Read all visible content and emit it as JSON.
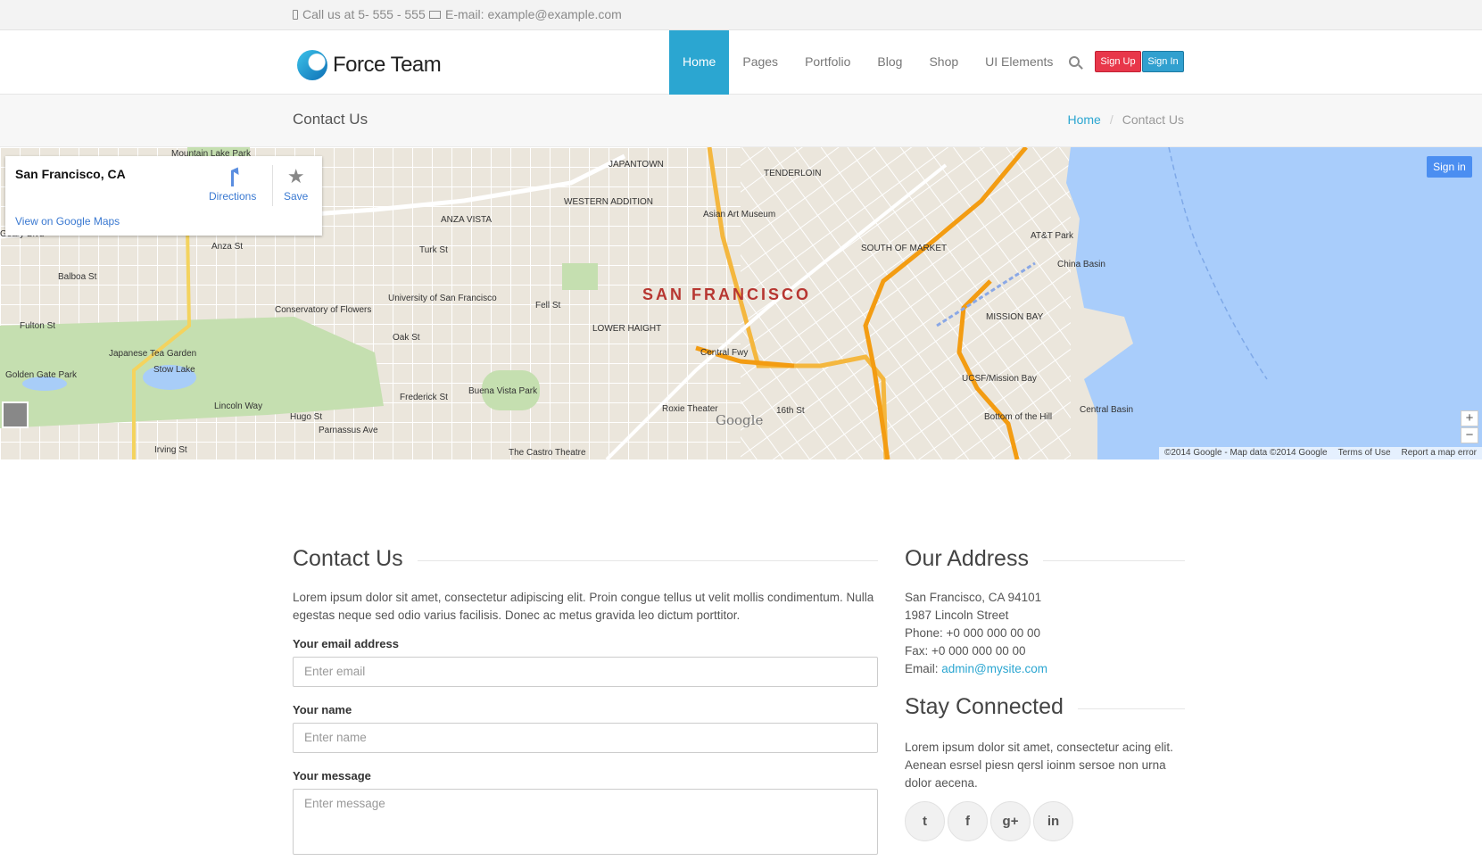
{
  "topbar": {
    "phone": "Call us at 5- 555 - 555",
    "email": "E-mail: example@example.com"
  },
  "header": {
    "logo_text": "Force Team",
    "nav": [
      "Home",
      "Pages",
      "Portfolio",
      "Blog",
      "Shop",
      "UI Elements"
    ],
    "active_nav": "Home",
    "sign_up": "Sign Up",
    "sign_in": "Sign In",
    "colors": {
      "accent": "#2ba6d1",
      "signup": "#e8374a"
    }
  },
  "page_header": {
    "title": "Contact Us",
    "breadcrumb": [
      "Home",
      "Contact Us"
    ]
  },
  "map": {
    "place": "San Francisco, CA",
    "directions": "Directions",
    "save": "Save",
    "view_link": "View on Google Maps",
    "sign_in": "Sign in",
    "city_label": "SAN FRANCISCO",
    "zoom_in": "+",
    "zoom_out": "−",
    "google": "Google",
    "attribution": "©2014 Google - Map data ©2014 Google",
    "terms": "Terms of Use",
    "report": "Report a map error",
    "labels": [
      "Geary Blvd",
      "Balboa St",
      "Fulton St",
      "Japanese Tea Garden",
      "Stow Lake",
      "Golden Gate Park",
      "Lincoln Way",
      "Conservatory of Flowers",
      "University of San Francisco",
      "Turk St",
      "Oak St",
      "Fell St",
      "Buena Vista Park",
      "Frederick St",
      "WESTERN ADDITION",
      "JAPANTOWN",
      "TENDERLOIN",
      "Asian Art Museum",
      "LOWER HAIGHT",
      "Central Fwy",
      "Roxie Theater",
      "16th St",
      "SOUTH OF MARKET",
      "MISSION BAY",
      "AT&T Park",
      "China Basin",
      "UCSF/Mission Bay",
      "Bottom of the Hill",
      "Central Basin",
      "Mountain Lake Park",
      "ANZA VISTA",
      "Anza St",
      "Irving St",
      "Hugo St",
      "Parnassus Ave",
      "The Castro Theatre"
    ]
  },
  "contact": {
    "heading": "Contact Us",
    "intro": "Lorem ipsum dolor sit amet, consectetur adipiscing elit. Proin congue tellus ut velit mollis condimentum. Nulla egestas neque sed odio varius facilisis. Donec ac metus gravida leo dictum porttitor.",
    "email_label": "Your email address",
    "email_placeholder": "Enter email",
    "name_label": "Your name",
    "name_placeholder": "Enter name",
    "message_label": "Your message",
    "message_placeholder": "Enter message"
  },
  "address": {
    "heading": "Our Address",
    "lines": [
      "San Francisco, CA 94101",
      "1987 Lincoln Street",
      "Phone: +0 000 000 00 00",
      "Fax: +0 000 000 00 00"
    ],
    "email_prefix": "Email:",
    "email": "admin@mysite.com"
  },
  "stay": {
    "heading": "Stay Connected",
    "text": "Lorem ipsum dolor sit amet, consectetur acing elit. Aenean esrsel piesn qersl ioinm sersoe non urna dolor aecena.",
    "social": [
      "twitter-icon",
      "facebook-icon",
      "google-plus-icon",
      "linkedin-icon"
    ]
  }
}
